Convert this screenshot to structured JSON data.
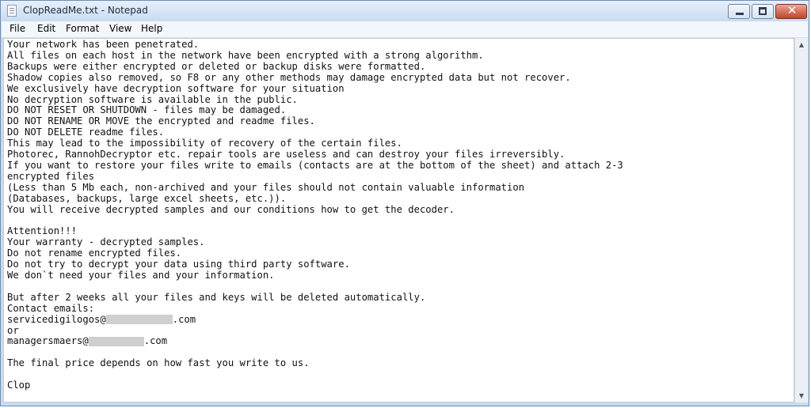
{
  "window": {
    "title": "ClopReadMe.txt - Notepad",
    "controls": {
      "minimize": "minimize",
      "maximize": "maximize",
      "close": "✕"
    }
  },
  "menu": [
    "File",
    "Edit",
    "Format",
    "View",
    "Help"
  ],
  "document": {
    "lines_before_email1": "Your network has been penetrated.\nAll files on each host in the network have been encrypted with a strong algorithm.\nBackups were either encrypted or deleted or backup disks were formatted.\nShadow copies also removed, so F8 or any other methods may damage encrypted data but not recover.\nWe exclusively have decryption software for your situation\nNo decryption software is available in the public.\nDO NOT RESET OR SHUTDOWN - files may be damaged.\nDO NOT RENAME OR MOVE the encrypted and readme files.\nDO NOT DELETE readme files.\nThis may lead to the impossibility of recovery of the certain files.\nPhotorec, RannohDecryptor etc. repair tools are useless and can destroy your files irreversibly.\nIf you want to restore your files write to emails (contacts are at the bottom of the sheet) and attach 2-3\nencrypted files\n(Less than 5 Mb each, non-archived and your files should not contain valuable information\n(Databases, backups, large excel sheets, etc.)).\nYou will receive decrypted samples and our conditions how to get the decoder.\n\nAttention!!!\nYour warranty - decrypted samples.\nDo not rename encrypted files.\nDo not try to decrypt your data using third party software.\nWe don`t need your files and your information.\n\nBut after 2 weeks all your files and keys will be deleted automatically.\nContact emails:\n",
    "email1_prefix": "servicedigilogos@",
    "email1_suffix": ".com",
    "or_line": "\nor\n",
    "email2_prefix": "managersmaers@",
    "email2_suffix": ".com",
    "lines_after_email2": "\n\nThe final price depends on how fast you write to us.\n\nClop"
  }
}
